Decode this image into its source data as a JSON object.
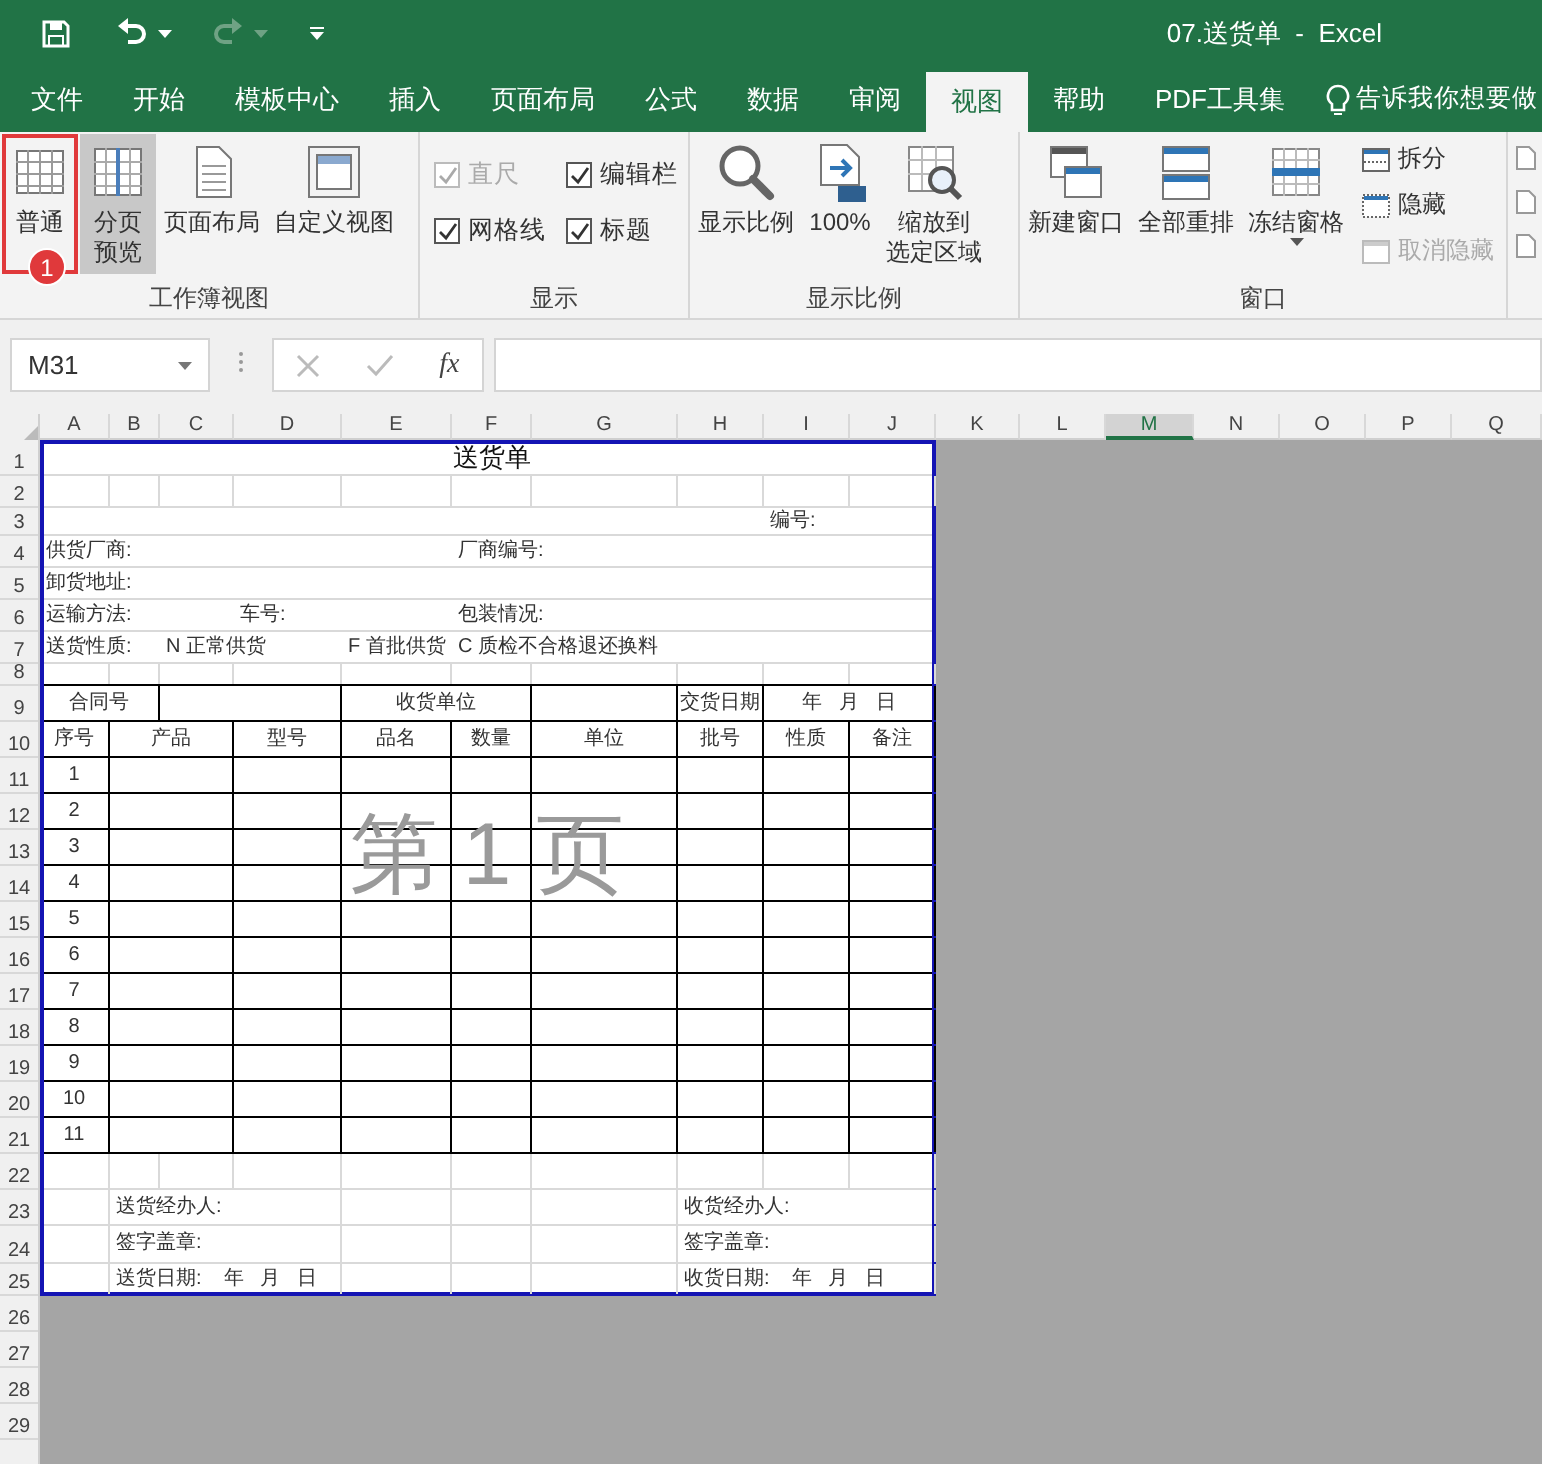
{
  "title_bar": {
    "title": "07.送货单  -  Excel"
  },
  "tabs": [
    {
      "label": "文件",
      "selected": false
    },
    {
      "label": "开始",
      "selected": false
    },
    {
      "label": "模板中心",
      "selected": false
    },
    {
      "label": "插入",
      "selected": false
    },
    {
      "label": "页面布局",
      "selected": false
    },
    {
      "label": "公式",
      "selected": false
    },
    {
      "label": "数据",
      "selected": false
    },
    {
      "label": "审阅",
      "selected": false
    },
    {
      "label": "视图",
      "selected": true
    },
    {
      "label": "帮助",
      "selected": false
    },
    {
      "label": "PDF工具集",
      "selected": false
    }
  ],
  "tell_me": "告诉我你想要做",
  "ribbon": {
    "groups": [
      {
        "label": "工作簿视图",
        "items": [
          {
            "kind": "large",
            "label": "普通",
            "selected": false,
            "highlighted": true,
            "badge": "1"
          },
          {
            "kind": "large",
            "label": "分页预览",
            "selected": true,
            "highlighted": false
          },
          {
            "kind": "large",
            "label": "页面布局",
            "selected": false,
            "highlighted": false
          },
          {
            "kind": "large",
            "label": "自定义视图",
            "selected": false,
            "highlighted": false
          }
        ]
      },
      {
        "label": "显示",
        "items": [
          {
            "kind": "check",
            "label": "直尺",
            "checked": true,
            "disabled": true
          },
          {
            "kind": "check",
            "label": "编辑栏",
            "checked": true,
            "disabled": false
          },
          {
            "kind": "check",
            "label": "网格线",
            "checked": true,
            "disabled": false
          },
          {
            "kind": "check",
            "label": "标题",
            "checked": true,
            "disabled": false
          }
        ]
      },
      {
        "label": "显示比例",
        "items": [
          {
            "kind": "large",
            "label": "显示比例"
          },
          {
            "kind": "large",
            "label": "100%"
          },
          {
            "kind": "large",
            "label": "缩放到选定区域"
          }
        ]
      },
      {
        "label": "窗口",
        "items": [
          {
            "kind": "large",
            "label": "新建窗口",
            "dropdown": false
          },
          {
            "kind": "large",
            "label": "全部重排",
            "dropdown": false
          },
          {
            "kind": "large",
            "label": "冻结窗格",
            "dropdown": true
          },
          {
            "kind": "small",
            "label": "拆分",
            "disabled": false
          },
          {
            "kind": "small",
            "label": "隐藏",
            "disabled": false
          },
          {
            "kind": "small",
            "label": "取消隐藏",
            "disabled": true
          }
        ]
      }
    ]
  },
  "formula_bar": {
    "name_box": "M31",
    "function_label": "fx"
  },
  "sheet": {
    "columns": [
      {
        "label": "A",
        "selected": false
      },
      {
        "label": "B",
        "selected": false
      },
      {
        "label": "C",
        "selected": false
      },
      {
        "label": "D",
        "selected": false
      },
      {
        "label": "E",
        "selected": false
      },
      {
        "label": "F",
        "selected": false
      },
      {
        "label": "G",
        "selected": false
      },
      {
        "label": "H",
        "selected": false
      },
      {
        "label": "I",
        "selected": false
      },
      {
        "label": "J",
        "selected": false
      },
      {
        "label": "K",
        "selected": false
      },
      {
        "label": "L",
        "selected": false
      },
      {
        "label": "M",
        "selected": true
      },
      {
        "label": "N",
        "selected": false
      },
      {
        "label": "O",
        "selected": false
      },
      {
        "label": "P",
        "selected": false
      },
      {
        "label": "Q",
        "selected": false
      }
    ],
    "row_headers": [
      "1",
      "2",
      "3",
      "4",
      "5",
      "6",
      "7",
      "8",
      "9",
      "10",
      "11",
      "12",
      "13",
      "14",
      "15",
      "16",
      "17",
      "18",
      "19",
      "20",
      "21",
      "22",
      "23",
      "24",
      "25",
      "26",
      "27",
      "28",
      "29"
    ],
    "page_label": "第 1 页",
    "rows": [
      {
        "kind": "title",
        "cells": [
          "",
          "",
          "",
          "",
          "",
          "送货单",
          "",
          "",
          "",
          ""
        ]
      },
      {
        "kind": "grid",
        "cells": [
          "",
          "",
          "",
          "",
          "",
          "",
          "",
          "",
          "",
          ""
        ]
      },
      {
        "kind": "line",
        "cells": [
          "",
          "",
          "",
          "",
          "",
          "",
          "",
          "",
          "编号:",
          ""
        ]
      },
      {
        "kind": "line",
        "cells": [
          "供货厂商:",
          "",
          "",
          "",
          "",
          "厂商编号:",
          "",
          "",
          "",
          ""
        ]
      },
      {
        "kind": "line",
        "cells": [
          "卸货地址:",
          "",
          "",
          "",
          "",
          "",
          "",
          "",
          "",
          ""
        ]
      },
      {
        "kind": "line",
        "cells": [
          "运输方法:",
          "",
          "",
          "车号:",
          "",
          "包装情况:",
          "",
          "",
          "",
          ""
        ]
      },
      {
        "kind": "line",
        "cells": [
          "送货性质:",
          "",
          "N 正常供货",
          "",
          "F 首批供货",
          "C 质检不合格退还换料",
          "",
          "",
          "",
          ""
        ]
      },
      {
        "kind": "grid",
        "cells": [
          "",
          "",
          "",
          "",
          "",
          "",
          "",
          "",
          "",
          ""
        ]
      },
      {
        "kind": "boxed",
        "cells": [
          "合同号",
          "",
          "",
          "",
          "收货单位",
          "",
          "",
          "交货日期",
          "年   月   日",
          ""
        ]
      },
      {
        "kind": "boxed",
        "cells": [
          "序号",
          "产品",
          "",
          "型号",
          "品名",
          "数量",
          "单位",
          "批号",
          "性质",
          "备注"
        ]
      },
      {
        "kind": "boxed",
        "cells": [
          "1",
          "",
          "",
          "",
          "",
          "",
          "",
          "",
          "",
          ""
        ]
      },
      {
        "kind": "boxed",
        "cells": [
          "2",
          "",
          "",
          "",
          "",
          "",
          "",
          "",
          "",
          ""
        ]
      },
      {
        "kind": "boxed",
        "cells": [
          "3",
          "",
          "",
          "",
          "",
          "",
          "",
          "",
          "",
          ""
        ]
      },
      {
        "kind": "boxed",
        "cells": [
          "4",
          "",
          "",
          "",
          "",
          "",
          "",
          "",
          "",
          ""
        ]
      },
      {
        "kind": "boxed",
        "cells": [
          "5",
          "",
          "",
          "",
          "",
          "",
          "",
          "",
          "",
          ""
        ]
      },
      {
        "kind": "boxed",
        "cells": [
          "6",
          "",
          "",
          "",
          "",
          "",
          "",
          "",
          "",
          ""
        ]
      },
      {
        "kind": "boxed",
        "cells": [
          "7",
          "",
          "",
          "",
          "",
          "",
          "",
          "",
          "",
          ""
        ]
      },
      {
        "kind": "boxed",
        "cells": [
          "8",
          "",
          "",
          "",
          "",
          "",
          "",
          "",
          "",
          ""
        ]
      },
      {
        "kind": "boxed",
        "cells": [
          "9",
          "",
          "",
          "",
          "",
          "",
          "",
          "",
          "",
          ""
        ]
      },
      {
        "kind": "boxed",
        "cells": [
          "10",
          "",
          "",
          "",
          "",
          "",
          "",
          "",
          "",
          ""
        ]
      },
      {
        "kind": "boxed",
        "cells": [
          "11",
          "",
          "",
          "",
          "",
          "",
          "",
          "",
          "",
          ""
        ]
      },
      {
        "kind": "grid",
        "cells": [
          "",
          "",
          "",
          "",
          "",
          "",
          "",
          "",
          "",
          ""
        ]
      },
      {
        "kind": "grid",
        "cells": [
          "",
          "送货经办人:",
          "",
          "",
          "",
          "",
          "",
          "收货经办人:",
          "",
          ""
        ]
      },
      {
        "kind": "grid",
        "cells": [
          "",
          "签字盖章:",
          "",
          "",
          "",
          "",
          "",
          "签字盖章:",
          "",
          ""
        ]
      },
      {
        "kind": "grid",
        "cells": [
          "",
          "送货日期:    年   月   日",
          "",
          "",
          "",
          "",
          "",
          "收货日期:    年   月   日",
          "",
          ""
        ]
      }
    ]
  }
}
